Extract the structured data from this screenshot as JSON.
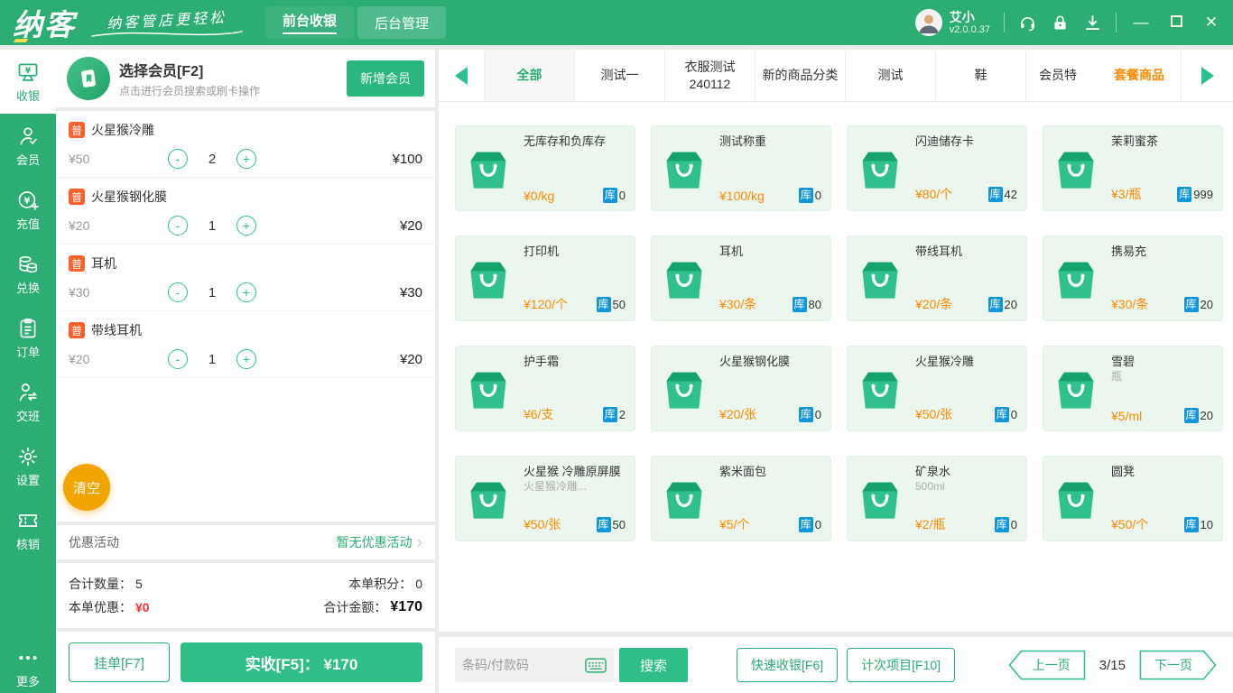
{
  "topbar": {
    "logo": "纳客",
    "slogan": "纳客管店更轻松",
    "nav": [
      {
        "label": "前台收银",
        "active": true
      },
      {
        "label": "后台管理"
      }
    ],
    "user_name": "艾小",
    "version": "v2.0.0.37",
    "window": {
      "minimize": "—",
      "close": "✕"
    }
  },
  "sidebar": {
    "items": [
      {
        "label": "收银",
        "active": true
      },
      {
        "label": "会员"
      },
      {
        "label": "充值"
      },
      {
        "label": "兑换"
      },
      {
        "label": "订单"
      },
      {
        "label": "交班"
      },
      {
        "label": "设置"
      },
      {
        "label": "核销"
      },
      {
        "label": "更多"
      }
    ]
  },
  "member_panel": {
    "title": "选择会员[F2]",
    "subtitle": "点击进行会员搜索或刷卡操作",
    "add_button": "新增会员"
  },
  "cart": {
    "minus": "-",
    "plus": "+",
    "clear_button": "清空",
    "items": [
      {
        "badge": "普",
        "name": "火星猴冷雕",
        "price": "¥50",
        "qty": "2",
        "total": "¥100"
      },
      {
        "badge": "普",
        "name": "火星猴钢化膜",
        "price": "¥20",
        "qty": "1",
        "total": "¥20"
      },
      {
        "badge": "普",
        "name": "耳机",
        "price": "¥30",
        "qty": "1",
        "total": "¥30"
      },
      {
        "badge": "普",
        "name": "带线耳机",
        "price": "¥20",
        "qty": "1",
        "total": "¥20"
      }
    ]
  },
  "promo": {
    "label": "优惠活动",
    "value": "暂无优惠活动",
    "chevron": "›"
  },
  "summary": {
    "qty_label": "合计数量：",
    "qty_value": "5",
    "points_label": "本单积分：",
    "points_value": "0",
    "discount_label": "本单优惠：",
    "discount_value": "¥0",
    "total_label": "合计金额：",
    "total_value": "¥170"
  },
  "checkout": {
    "hold_button": "挂单[F7]",
    "pay_button": "实收[F5]： ¥170"
  },
  "categories": {
    "tabs": [
      {
        "label": "全部",
        "active": true
      },
      {
        "label": "测试一"
      },
      {
        "label": "衣服测试240112"
      },
      {
        "label": "新的商品分类"
      },
      {
        "label": "测试"
      },
      {
        "label": "鞋"
      },
      {
        "label": "会员特",
        "truncated": true
      },
      {
        "label": "套餐商品",
        "special": true
      }
    ]
  },
  "labels": {
    "stock": "库"
  },
  "products": [
    {
      "name": "无库存和负库存",
      "price": "¥0/kg",
      "stock": "0"
    },
    {
      "name": "测试称重",
      "price": "¥100/kg",
      "stock": "0"
    },
    {
      "name": "闪迪储存卡",
      "price": "¥80/个",
      "stock": "42"
    },
    {
      "name": "茉莉蜜茶",
      "price": "¥3/瓶",
      "stock": "999"
    },
    {
      "name": "打印机",
      "price": "¥120/个",
      "stock": "50"
    },
    {
      "name": "耳机",
      "price": "¥30/条",
      "stock": "80"
    },
    {
      "name": "带线耳机",
      "price": "¥20/条",
      "stock": "20"
    },
    {
      "name": "携易充",
      "price": "¥30/条",
      "stock": "20"
    },
    {
      "name": "护手霜",
      "price": "¥6/支",
      "stock": "2"
    },
    {
      "name": "火星猴钢化膜",
      "price": "¥20/张",
      "stock": "0"
    },
    {
      "name": "火星猴冷雕",
      "price": "¥50/张",
      "stock": "0"
    },
    {
      "name": "雪碧",
      "subtitle": "瓶",
      "price": "¥5/ml",
      "stock": "20"
    },
    {
      "name": "火星猴 冷雕原屏膜",
      "subtitle": "火星猴冷雕...",
      "price": "¥50/张",
      "stock": "50"
    },
    {
      "name": "紫米面包",
      "price": "¥5/个",
      "stock": "0"
    },
    {
      "name": "矿泉水",
      "subtitle": "500ml",
      "price": "¥2/瓶",
      "stock": "0"
    },
    {
      "name": "圆凳",
      "price": "¥50/个",
      "stock": "10"
    }
  ],
  "bottombar": {
    "search_placeholder": "条码/付款码",
    "search_button": "搜索",
    "quick_button": "快速收银[F6]",
    "count_button": "计次项目[F10]",
    "prev": "上一页",
    "page": "3/15",
    "next": "下一页"
  }
}
